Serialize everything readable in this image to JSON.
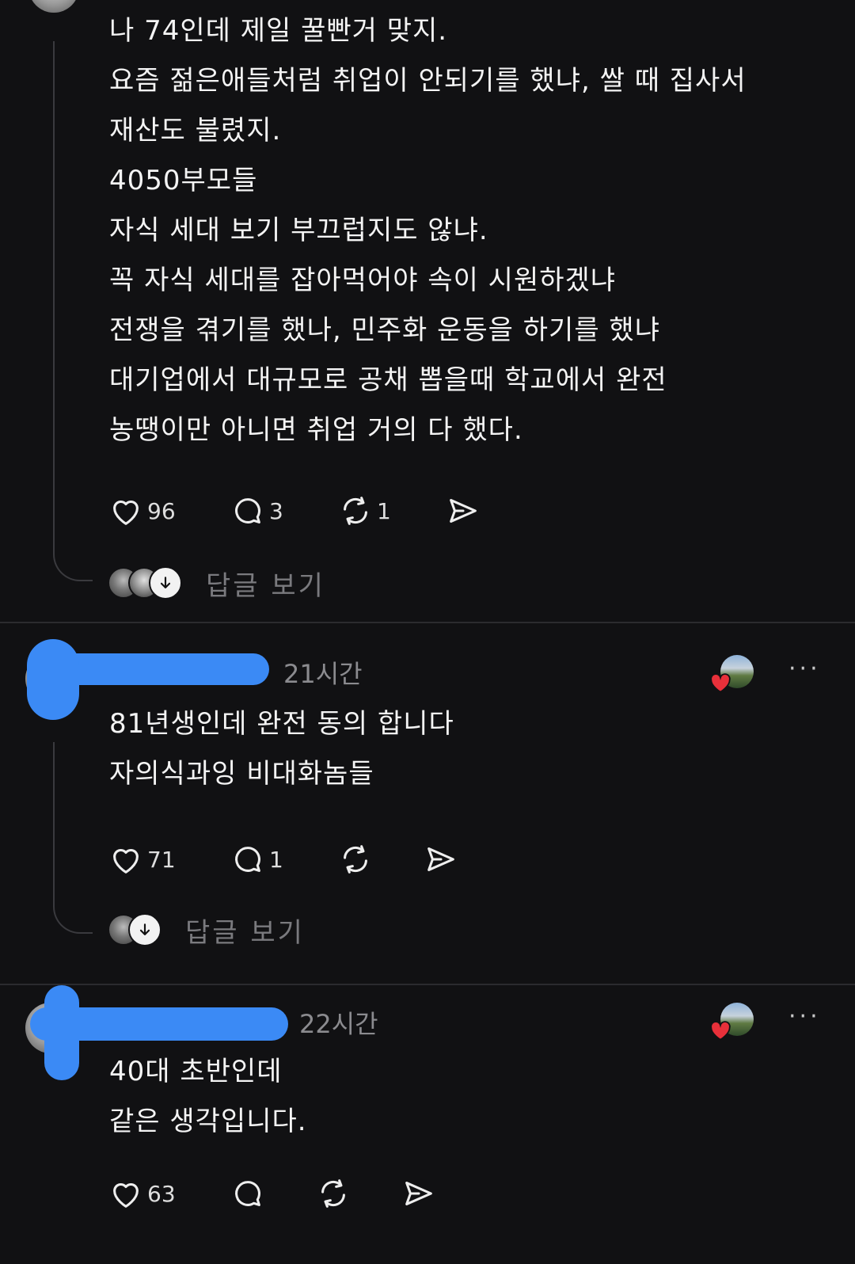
{
  "post1": {
    "lines": [
      "나 74인데 제일 꿀빤거 맞지.",
      "요즘 젊은애들처럼 취업이 안되기를 했냐, 쌀 때 집사서",
      "재산도 불렸지.",
      "4050부모들",
      "자식 세대 보기 부끄럽지도 않냐.",
      "꼭 자식 세대를 잡아먹어야 속이 시원하겠냐",
      "전쟁을 겪기를 했나, 민주화 운동을 하기를 했냐",
      "대기업에서 대규모로 공채 뽑을때 학교에서 완전",
      "농땡이만 아니면 취업 거의 다 했다."
    ],
    "likes": "96",
    "comments": "3",
    "reposts": "1",
    "view_replies": "답글 보기"
  },
  "post2": {
    "time": "21시간",
    "lines": [
      "81년생인데 완전 동의 합니다",
      "자의식과잉 비대화놈들"
    ],
    "likes": "71",
    "comments": "1",
    "view_replies": "답글 보기",
    "more": "···"
  },
  "post3": {
    "time": "22시간",
    "lines": [
      "40대 초반인데",
      "같은 생각입니다."
    ],
    "likes": "63",
    "more": "···"
  },
  "icons": {
    "like": "heart-icon",
    "comment": "comment-icon",
    "repost": "repost-icon",
    "share": "send-icon",
    "down": "arrow-down-icon",
    "more": "more-icon"
  },
  "colors": {
    "background": "#111113",
    "text": "#f4f4f4",
    "muted": "#8b8b8f",
    "redaction": "#3b8af5",
    "heart": "#e8303a"
  }
}
